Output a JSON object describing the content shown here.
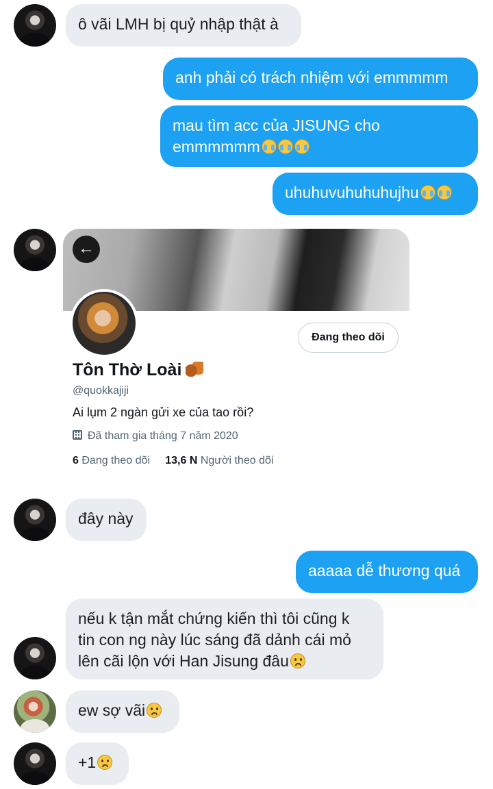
{
  "messages": [
    {
      "text": "ô vãi LMH bị quỷ nhập thật à"
    },
    {
      "text": "anh phải có trách nhiệm với emmmmm"
    },
    {
      "text": "mau tìm acc của JISUNG cho",
      "text2": "emmmmmm"
    },
    {
      "text": "uhuhuvuhuhuhujhu"
    },
    {
      "text": "đây này"
    },
    {
      "text": "aaaaa dễ thương quá"
    },
    {
      "text": "nếu k tận mắt chứng kiến thì tôi cũng k",
      "text2": "tin con ng này lúc sáng đã dảnh cái mỏ",
      "text3": "lên cãi lộn với Han Jisung đâu"
    },
    {
      "text": "ew sợ vãi"
    },
    {
      "text": "+1"
    }
  ],
  "profile": {
    "name": "Tôn Thờ Loài",
    "handle": "@quokkajiji",
    "bio": "Ai lụm 2 ngàn gửi xe của tao rồi?",
    "joined": "Đã tham gia tháng 7 năm 2020",
    "following_count": "6",
    "following_label": "Đang theo dõi",
    "followers_count": "13,6 N",
    "followers_label": "Người theo dõi",
    "follow_button": "Đang theo dõi",
    "back_icon": "←"
  },
  "colors": {
    "outgoing_bubble": "#1da1f2",
    "incoming_bubble": "#e9ecf0"
  },
  "icons": [
    "avatar",
    "back-arrow-icon",
    "calendar-icon",
    "squirrel-emoji",
    "loudly-crying-emoji",
    "worried-emoji"
  ]
}
